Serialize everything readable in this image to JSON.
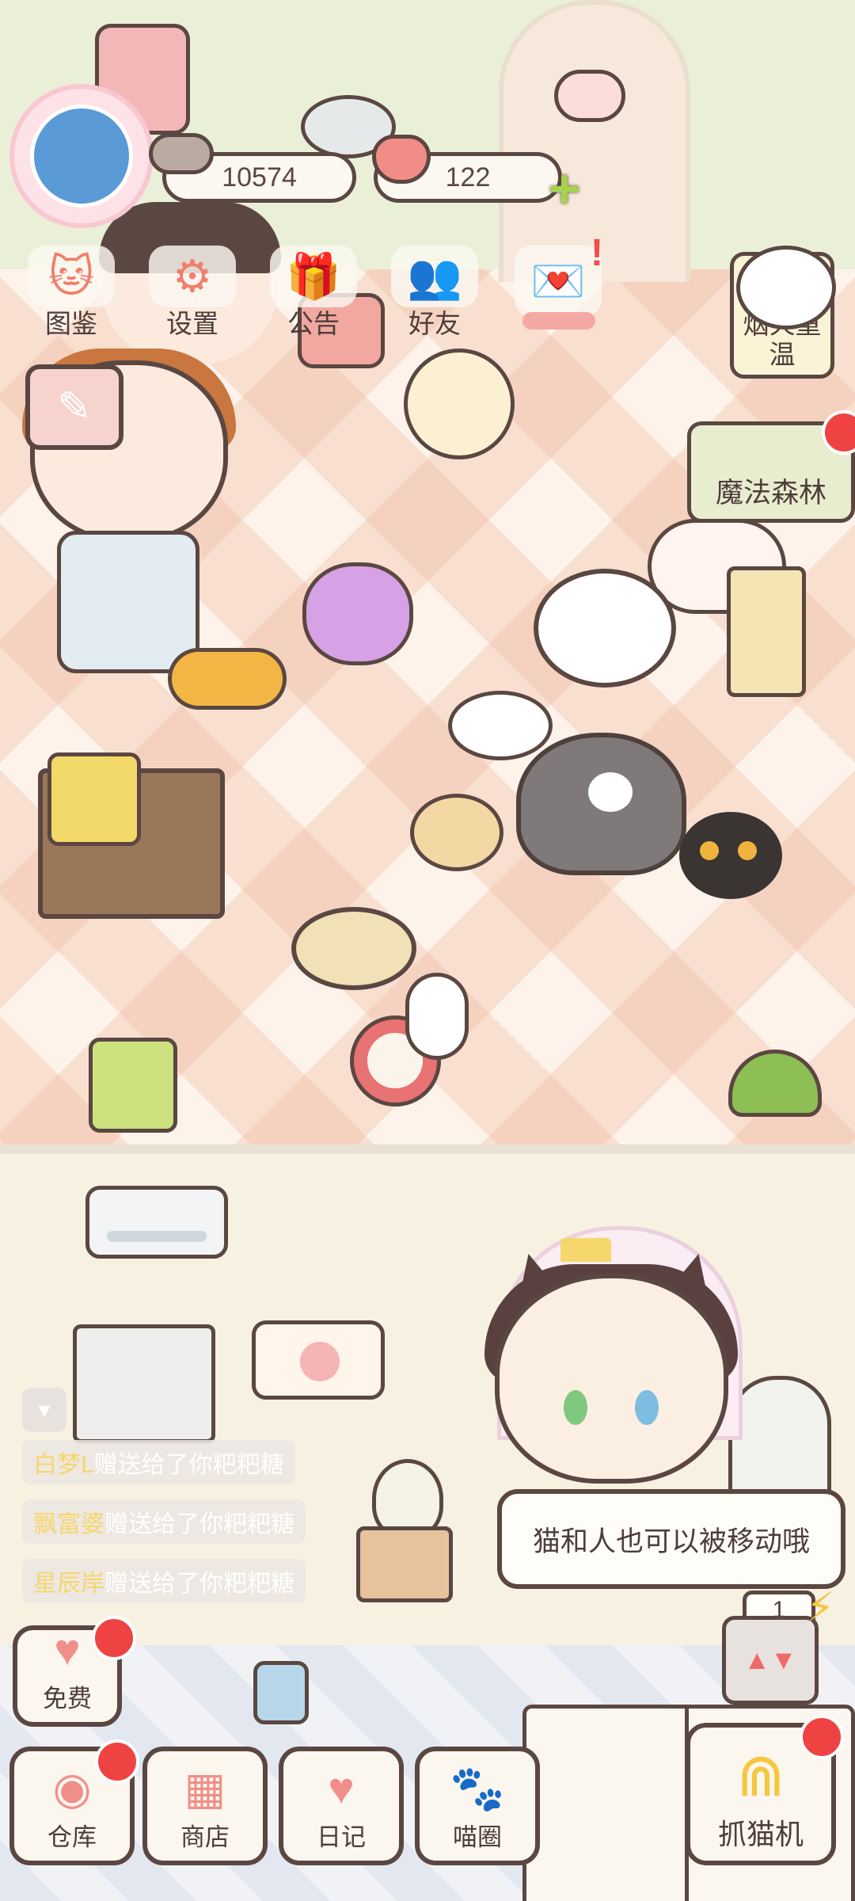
{
  "currencies": {
    "coins": "10574",
    "hearts": "122"
  },
  "top_menu": [
    {
      "label": "图鉴",
      "icon": "cat-head-icon",
      "glyph": "🐱"
    },
    {
      "label": "设置",
      "icon": "gear-icon",
      "glyph": "⚙"
    },
    {
      "label": "公告",
      "icon": "gift-icon",
      "glyph": "🎁"
    },
    {
      "label": "好友",
      "icon": "friends-icon",
      "glyph": "👥"
    },
    {
      "label": "",
      "icon": "heart-mail-icon",
      "glyph": "💌"
    }
  ],
  "side_cards": {
    "fireworks_label": "烟火重温",
    "forest_label": "魔法森林"
  },
  "notifications": {
    "excl": "!"
  },
  "chat": [
    {
      "user": "白梦L",
      "text": "赠送给了你粑粑糖"
    },
    {
      "user": "飘富婆",
      "text": "赠送给了你粑粑糖"
    },
    {
      "user": "星辰岸",
      "text": "赠送给了你粑粑糖"
    }
  ],
  "speech_bubble": "猫和人也可以被移动哦",
  "machine_counter": "1",
  "bottom_nav": {
    "free": "免费",
    "items": [
      {
        "label": "仓库",
        "icon": "storage-icon",
        "glyph": "◉"
      },
      {
        "label": "商店",
        "icon": "shop-icon",
        "glyph": "▦"
      },
      {
        "label": "日记",
        "icon": "diary-icon",
        "glyph": "♥"
      },
      {
        "label": "喵圈",
        "icon": "cat-planet-icon",
        "glyph": "🐾"
      }
    ],
    "claw_machine": "抓猫机"
  },
  "colors": {
    "outline": "#5b4742",
    "accent_pink": "#f28c87",
    "badge_red": "#ef4343",
    "plus_green": "#a5d34e"
  }
}
